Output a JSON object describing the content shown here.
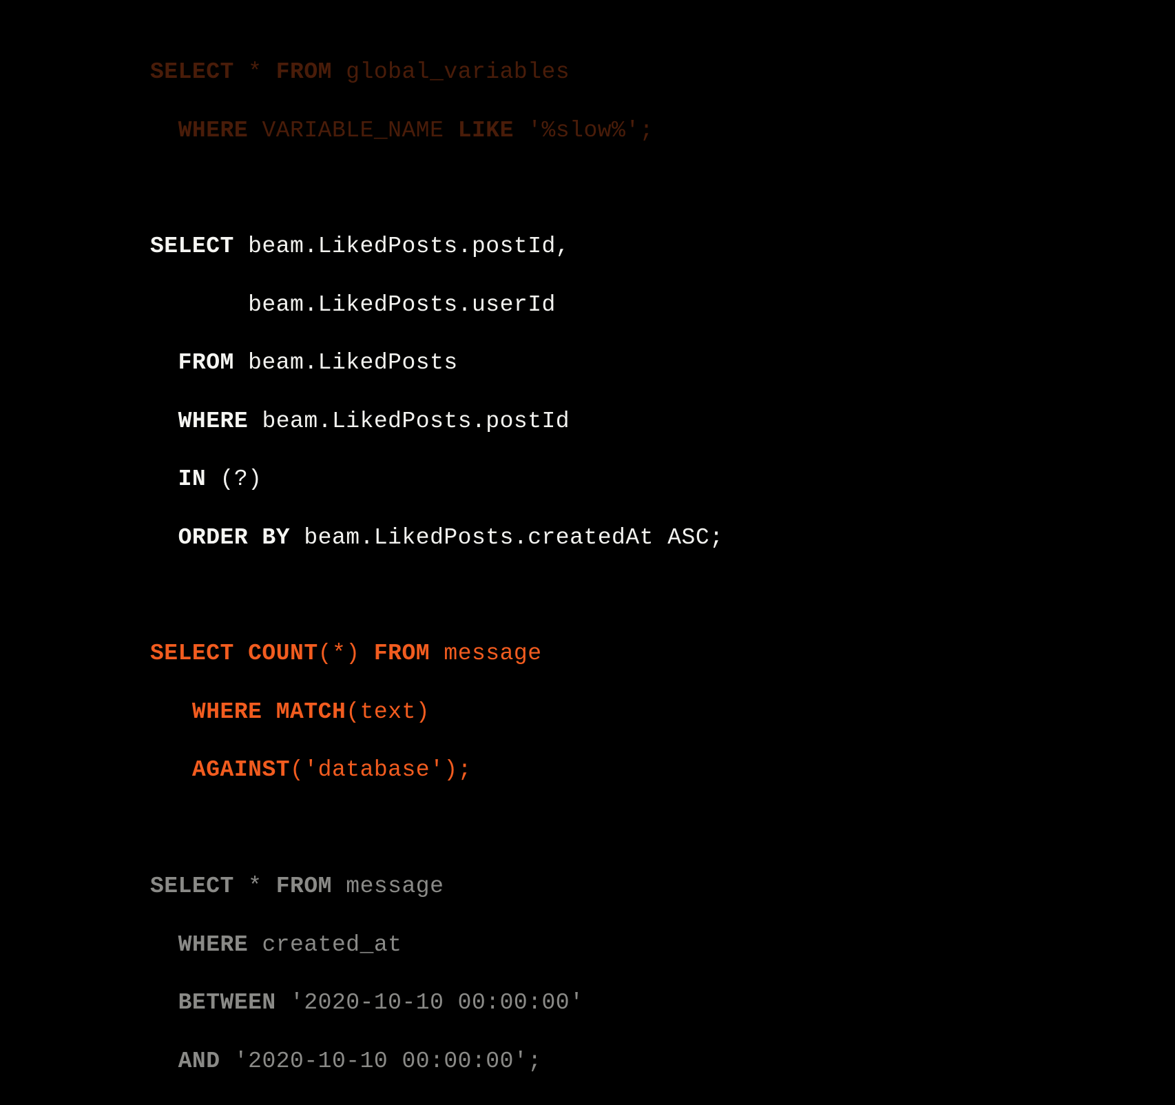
{
  "q1": {
    "l1_kw1": "SELECT",
    "l1_star": " * ",
    "l1_kw2": "FROM",
    "l1_rest": " global_variables",
    "l2_indent": "  ",
    "l2_kw": "WHERE",
    "l2_mid": " VARIABLE_NAME ",
    "l2_kw2": "LIKE",
    "l2_rest": " '%slow%';"
  },
  "q2": {
    "l1_kw": "SELECT",
    "l1_rest": " beam.LikedPosts.postId,",
    "l2_indent": "       ",
    "l2_rest": "beam.LikedPosts.userId",
    "l3_indent": "  ",
    "l3_kw": "FROM",
    "l3_rest": " beam.LikedPosts",
    "l4_indent": "  ",
    "l4_kw": "WHERE",
    "l4_rest": " beam.LikedPosts.postId",
    "l5_indent": "  ",
    "l5_kw": "IN",
    "l5_rest": " (?)",
    "l6_indent": "  ",
    "l6_kw": "ORDER BY",
    "l6_rest": " beam.LikedPosts.createdAt ASC;"
  },
  "q3": {
    "l1_kw1": "SELECT",
    "l1_kw2": " COUNT",
    "l1_args": "(*) ",
    "l1_kw3": "FROM",
    "l1_rest": " message",
    "l2_indent": "   ",
    "l2_kw": "WHERE",
    "l2_kw2": " MATCH",
    "l2_rest": "(text)",
    "l3_indent": "   ",
    "l3_kw": "AGAINST",
    "l3_rest": "('database');"
  },
  "q4": {
    "l1_kw1": "SELECT",
    "l1_star": " * ",
    "l1_kw2": "FROM",
    "l1_rest": " message",
    "l2_indent": "  ",
    "l2_kw": "WHERE",
    "l2_rest": " created_at",
    "l3_indent": "  ",
    "l3_kw": "BETWEEN",
    "l3_rest": " '2020-10-10 00:00:00'",
    "l4_indent": "  ",
    "l4_kw": "AND",
    "l4_rest": " '2020-10-10 00:00:00';"
  }
}
